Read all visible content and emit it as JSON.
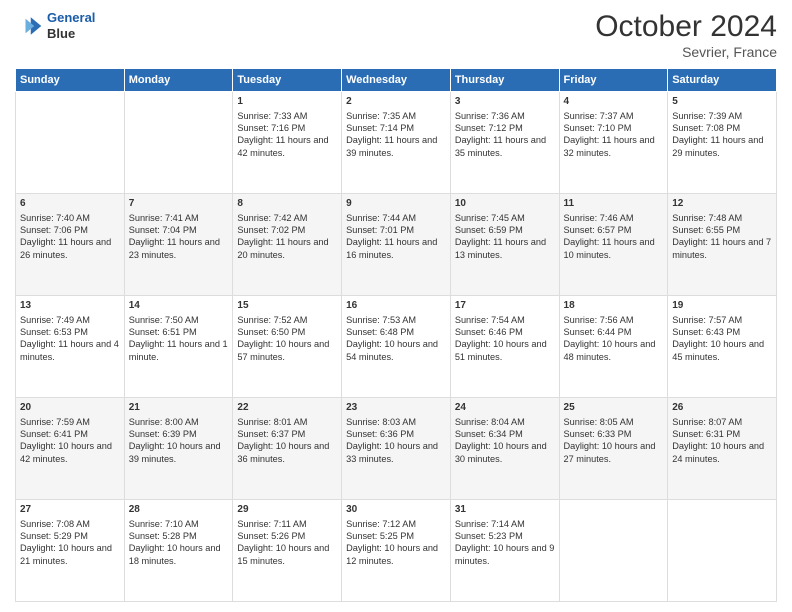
{
  "header": {
    "logo_line1": "General",
    "logo_line2": "Blue",
    "title": "October 2024",
    "subtitle": "Sevrier, France"
  },
  "columns": [
    "Sunday",
    "Monday",
    "Tuesday",
    "Wednesday",
    "Thursday",
    "Friday",
    "Saturday"
  ],
  "rows": [
    [
      {
        "day": "",
        "info": ""
      },
      {
        "day": "",
        "info": ""
      },
      {
        "day": "1",
        "info": "Sunrise: 7:33 AM\nSunset: 7:16 PM\nDaylight: 11 hours and 42 minutes."
      },
      {
        "day": "2",
        "info": "Sunrise: 7:35 AM\nSunset: 7:14 PM\nDaylight: 11 hours and 39 minutes."
      },
      {
        "day": "3",
        "info": "Sunrise: 7:36 AM\nSunset: 7:12 PM\nDaylight: 11 hours and 35 minutes."
      },
      {
        "day": "4",
        "info": "Sunrise: 7:37 AM\nSunset: 7:10 PM\nDaylight: 11 hours and 32 minutes."
      },
      {
        "day": "5",
        "info": "Sunrise: 7:39 AM\nSunset: 7:08 PM\nDaylight: 11 hours and 29 minutes."
      }
    ],
    [
      {
        "day": "6",
        "info": "Sunrise: 7:40 AM\nSunset: 7:06 PM\nDaylight: 11 hours and 26 minutes."
      },
      {
        "day": "7",
        "info": "Sunrise: 7:41 AM\nSunset: 7:04 PM\nDaylight: 11 hours and 23 minutes."
      },
      {
        "day": "8",
        "info": "Sunrise: 7:42 AM\nSunset: 7:02 PM\nDaylight: 11 hours and 20 minutes."
      },
      {
        "day": "9",
        "info": "Sunrise: 7:44 AM\nSunset: 7:01 PM\nDaylight: 11 hours and 16 minutes."
      },
      {
        "day": "10",
        "info": "Sunrise: 7:45 AM\nSunset: 6:59 PM\nDaylight: 11 hours and 13 minutes."
      },
      {
        "day": "11",
        "info": "Sunrise: 7:46 AM\nSunset: 6:57 PM\nDaylight: 11 hours and 10 minutes."
      },
      {
        "day": "12",
        "info": "Sunrise: 7:48 AM\nSunset: 6:55 PM\nDaylight: 11 hours and 7 minutes."
      }
    ],
    [
      {
        "day": "13",
        "info": "Sunrise: 7:49 AM\nSunset: 6:53 PM\nDaylight: 11 hours and 4 minutes."
      },
      {
        "day": "14",
        "info": "Sunrise: 7:50 AM\nSunset: 6:51 PM\nDaylight: 11 hours and 1 minute."
      },
      {
        "day": "15",
        "info": "Sunrise: 7:52 AM\nSunset: 6:50 PM\nDaylight: 10 hours and 57 minutes."
      },
      {
        "day": "16",
        "info": "Sunrise: 7:53 AM\nSunset: 6:48 PM\nDaylight: 10 hours and 54 minutes."
      },
      {
        "day": "17",
        "info": "Sunrise: 7:54 AM\nSunset: 6:46 PM\nDaylight: 10 hours and 51 minutes."
      },
      {
        "day": "18",
        "info": "Sunrise: 7:56 AM\nSunset: 6:44 PM\nDaylight: 10 hours and 48 minutes."
      },
      {
        "day": "19",
        "info": "Sunrise: 7:57 AM\nSunset: 6:43 PM\nDaylight: 10 hours and 45 minutes."
      }
    ],
    [
      {
        "day": "20",
        "info": "Sunrise: 7:59 AM\nSunset: 6:41 PM\nDaylight: 10 hours and 42 minutes."
      },
      {
        "day": "21",
        "info": "Sunrise: 8:00 AM\nSunset: 6:39 PM\nDaylight: 10 hours and 39 minutes."
      },
      {
        "day": "22",
        "info": "Sunrise: 8:01 AM\nSunset: 6:37 PM\nDaylight: 10 hours and 36 minutes."
      },
      {
        "day": "23",
        "info": "Sunrise: 8:03 AM\nSunset: 6:36 PM\nDaylight: 10 hours and 33 minutes."
      },
      {
        "day": "24",
        "info": "Sunrise: 8:04 AM\nSunset: 6:34 PM\nDaylight: 10 hours and 30 minutes."
      },
      {
        "day": "25",
        "info": "Sunrise: 8:05 AM\nSunset: 6:33 PM\nDaylight: 10 hours and 27 minutes."
      },
      {
        "day": "26",
        "info": "Sunrise: 8:07 AM\nSunset: 6:31 PM\nDaylight: 10 hours and 24 minutes."
      }
    ],
    [
      {
        "day": "27",
        "info": "Sunrise: 7:08 AM\nSunset: 5:29 PM\nDaylight: 10 hours and 21 minutes."
      },
      {
        "day": "28",
        "info": "Sunrise: 7:10 AM\nSunset: 5:28 PM\nDaylight: 10 hours and 18 minutes."
      },
      {
        "day": "29",
        "info": "Sunrise: 7:11 AM\nSunset: 5:26 PM\nDaylight: 10 hours and 15 minutes."
      },
      {
        "day": "30",
        "info": "Sunrise: 7:12 AM\nSunset: 5:25 PM\nDaylight: 10 hours and 12 minutes."
      },
      {
        "day": "31",
        "info": "Sunrise: 7:14 AM\nSunset: 5:23 PM\nDaylight: 10 hours and 9 minutes."
      },
      {
        "day": "",
        "info": ""
      },
      {
        "day": "",
        "info": ""
      }
    ]
  ]
}
